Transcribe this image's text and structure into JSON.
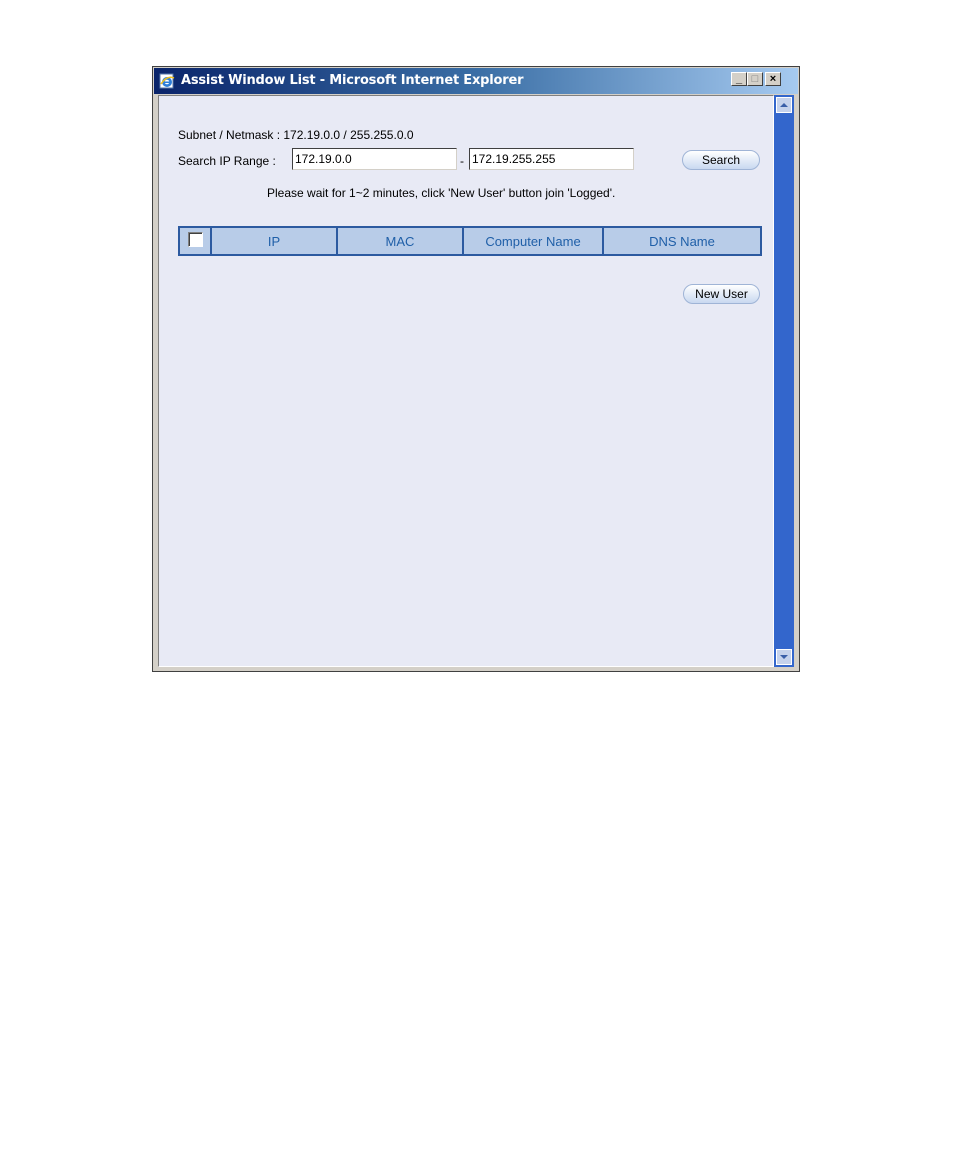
{
  "window": {
    "title": "Assist Window List - Microsoft Internet Explorer",
    "controls": {
      "minimize": "_",
      "maximize": "□",
      "close": "×"
    }
  },
  "form": {
    "subnet_label": "Subnet / Netmask : 172.19.0.0 / 255.255.0.0",
    "range_label": "Search IP Range :",
    "range_start": "172.19.0.0",
    "range_sep": "-",
    "range_end": "172.19.255.255",
    "search_button": "Search",
    "notice": "Please wait for 1~2 minutes, click 'New User' button join 'Logged'."
  },
  "table": {
    "columns": [
      "IP",
      "MAC",
      "Computer Name",
      "DNS Name"
    ],
    "rows": []
  },
  "actions": {
    "new_user_button": "New User"
  },
  "colors": {
    "header_bg": "#b8cce8",
    "header_border": "#2c5aa0",
    "header_text": "#1f5fa8",
    "scrollbar": "#3366cc",
    "page_bg": "#e8eaf5"
  }
}
